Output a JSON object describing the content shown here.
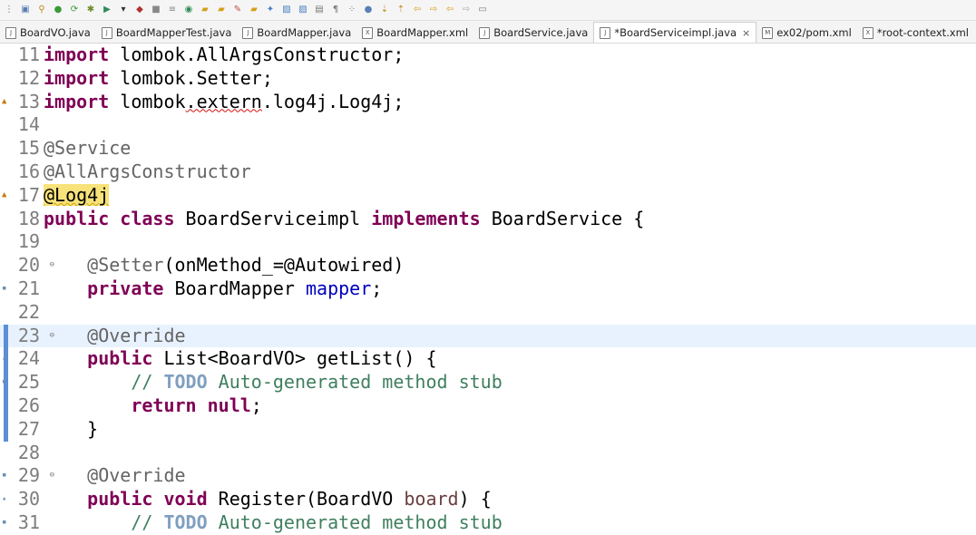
{
  "tabs": [
    {
      "label": "BoardVO.java",
      "icon": "java-file-icon",
      "active": false
    },
    {
      "label": "BoardMapperTest.java",
      "icon": "java-file-icon",
      "active": false
    },
    {
      "label": "BoardMapper.java",
      "icon": "java-file-icon",
      "active": false
    },
    {
      "label": "BoardMapper.xml",
      "icon": "xml-file-icon",
      "active": false
    },
    {
      "label": "BoardService.java",
      "icon": "java-file-icon",
      "active": false
    },
    {
      "label": "*BoardServiceimpl.java",
      "icon": "java-file-icon",
      "active": true,
      "close": "×"
    },
    {
      "label": "ex02/pom.xml",
      "icon": "maven-file-icon",
      "active": false
    },
    {
      "label": "*root-context.xml",
      "icon": "xml-file-icon",
      "active": false
    }
  ],
  "editor": {
    "lines": [
      {
        "n": "11",
        "tokens": [
          {
            "t": "import",
            "c": "kw"
          },
          {
            "t": " lombok.AllArgsConstructor;",
            "c": ""
          }
        ]
      },
      {
        "n": "12",
        "tokens": [
          {
            "t": "import",
            "c": "kw"
          },
          {
            "t": " lombok.Setter;",
            "c": ""
          }
        ]
      },
      {
        "n": "13",
        "marker": "warning",
        "tokens": [
          {
            "t": "import",
            "c": "kw"
          },
          {
            "t": " lombok",
            "c": ""
          },
          {
            "t": ".extern",
            "c": "squig"
          },
          {
            "t": ".log4j.Log4j;",
            "c": ""
          }
        ]
      },
      {
        "n": "14",
        "tokens": []
      },
      {
        "n": "15",
        "tokens": [
          {
            "t": "@Service",
            "c": "ann"
          }
        ]
      },
      {
        "n": "16",
        "tokens": [
          {
            "t": "@AllArgsConstructor",
            "c": "ann"
          }
        ]
      },
      {
        "n": "17",
        "marker": "warning",
        "tokens": [
          {
            "t": "@Log4j",
            "c": "warnhl"
          }
        ]
      },
      {
        "n": "18",
        "tokens": [
          {
            "t": "public",
            "c": "kw"
          },
          {
            "t": " ",
            "c": ""
          },
          {
            "t": "class",
            "c": "kw"
          },
          {
            "t": " BoardServiceimpl ",
            "c": ""
          },
          {
            "t": "implements",
            "c": "kw"
          },
          {
            "t": " BoardService {",
            "c": ""
          }
        ]
      },
      {
        "n": "19",
        "tokens": []
      },
      {
        "n": "20",
        "fold": "⊖",
        "tokens": [
          {
            "t": "    ",
            "c": ""
          },
          {
            "t": "@Setter",
            "c": "ann"
          },
          {
            "t": "(onMethod_=@Autowired)",
            "c": ""
          }
        ]
      },
      {
        "n": "21",
        "marker": "info",
        "tokens": [
          {
            "t": "    ",
            "c": ""
          },
          {
            "t": "private",
            "c": "kw"
          },
          {
            "t": " BoardMapper ",
            "c": ""
          },
          {
            "t": "mapper",
            "c": "fld"
          },
          {
            "t": ";",
            "c": ""
          }
        ]
      },
      {
        "n": "22",
        "tokens": []
      },
      {
        "n": "23",
        "fold": "⊖",
        "highlight": true,
        "bar": true,
        "tokens": [
          {
            "t": "    ",
            "c": ""
          },
          {
            "t": "@Override",
            "c": "ann"
          }
        ]
      },
      {
        "n": "24",
        "marker": "override",
        "bar": true,
        "tokens": [
          {
            "t": "    ",
            "c": ""
          },
          {
            "t": "public",
            "c": "kw"
          },
          {
            "t": " List<BoardVO> getList() {",
            "c": ""
          }
        ]
      },
      {
        "n": "25",
        "marker": "info",
        "bar": true,
        "tokens": [
          {
            "t": "        // ",
            "c": "cm"
          },
          {
            "t": "TODO",
            "c": "todo"
          },
          {
            "t": " Auto-generated method stub",
            "c": "cm"
          }
        ]
      },
      {
        "n": "26",
        "bar": true,
        "tokens": [
          {
            "t": "        ",
            "c": ""
          },
          {
            "t": "return",
            "c": "kw"
          },
          {
            "t": " ",
            "c": ""
          },
          {
            "t": "null",
            "c": "kw"
          },
          {
            "t": ";",
            "c": ""
          }
        ]
      },
      {
        "n": "27",
        "bar": true,
        "tokens": [
          {
            "t": "    }",
            "c": ""
          }
        ]
      },
      {
        "n": "28",
        "tokens": []
      },
      {
        "n": "29",
        "marker": "info",
        "fold": "⊖",
        "tokens": [
          {
            "t": "    ",
            "c": ""
          },
          {
            "t": "@Override",
            "c": "ann"
          }
        ]
      },
      {
        "n": "30",
        "marker": "override",
        "tokens": [
          {
            "t": "    ",
            "c": ""
          },
          {
            "t": "public",
            "c": "kw"
          },
          {
            "t": " ",
            "c": ""
          },
          {
            "t": "void",
            "c": "kw"
          },
          {
            "t": " Register(BoardVO ",
            "c": ""
          },
          {
            "t": "board",
            "c": "param"
          },
          {
            "t": ") {",
            "c": ""
          }
        ]
      },
      {
        "n": "31",
        "marker": "info",
        "tokens": [
          {
            "t": "        // ",
            "c": "cm"
          },
          {
            "t": "TODO",
            "c": "todo"
          },
          {
            "t": " Auto-generated method stub",
            "c": "cm"
          }
        ]
      }
    ]
  }
}
